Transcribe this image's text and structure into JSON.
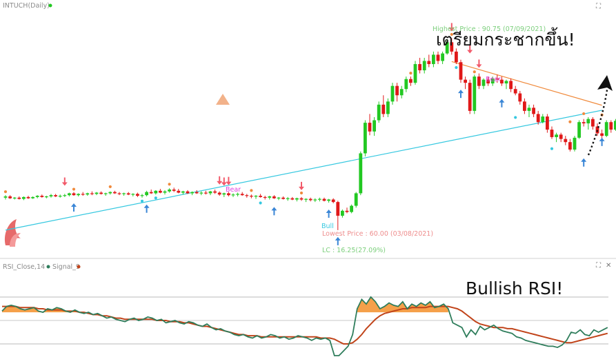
{
  "chart_data": [
    {
      "type": "candlestick",
      "title": "INTUCH(Daily)",
      "price_range": [
        58,
        93
      ],
      "annotations": {
        "highest": "Highest Price : 90.75 (07/09/2021)",
        "lowest": "Lowest Price : 60.00 (03/08/2021)",
        "lc": "LC : 16.25(27.09%)",
        "bear_1": "Bear",
        "bear_2": "Bear",
        "bull": "Bull",
        "headline": "เตรียมกระชากขึ้น!"
      },
      "colors": {
        "up": "#22c822",
        "down": "#e01818",
        "support": "#35c8e0",
        "resistance": "#f08a3c"
      },
      "trendlines": [
        {
          "name": "support",
          "from": [
            0,
            60.0
          ],
          "to": [
            131,
            79.2
          ]
        },
        {
          "name": "resistance",
          "from": [
            98,
            87.0
          ],
          "to": [
            131,
            80.0
          ]
        }
      ],
      "candles": [
        [
          65.2,
          65.6,
          64.9,
          65.4
        ],
        [
          65.4,
          65.6,
          65.0,
          65.1
        ],
        [
          65.1,
          65.3,
          64.9,
          65.2
        ],
        [
          65.2,
          65.4,
          64.9,
          65.0
        ],
        [
          65.0,
          65.4,
          64.8,
          65.3
        ],
        [
          65.3,
          65.5,
          65.0,
          65.1
        ],
        [
          65.1,
          65.4,
          65.0,
          65.3
        ],
        [
          65.3,
          65.6,
          65.1,
          65.5
        ],
        [
          65.5,
          65.7,
          65.2,
          65.3
        ],
        [
          65.3,
          65.5,
          65.1,
          65.4
        ],
        [
          65.4,
          65.8,
          65.2,
          65.6
        ],
        [
          65.6,
          65.8,
          65.3,
          65.4
        ],
        [
          65.4,
          65.7,
          65.2,
          65.5
        ],
        [
          65.5,
          65.8,
          65.3,
          65.6
        ],
        [
          65.6,
          66.0,
          65.4,
          65.9
        ],
        [
          65.9,
          66.1,
          65.5,
          65.6
        ],
        [
          65.6,
          65.9,
          65.4,
          65.8
        ],
        [
          65.8,
          66.1,
          65.5,
          65.7
        ],
        [
          65.7,
          66.0,
          65.5,
          65.9
        ],
        [
          65.9,
          66.2,
          65.6,
          65.8
        ],
        [
          65.8,
          66.1,
          65.6,
          66.0
        ],
        [
          66.0,
          66.2,
          65.7,
          65.8
        ],
        [
          65.8,
          66.0,
          65.5,
          65.9
        ],
        [
          65.9,
          66.2,
          65.7,
          66.1
        ],
        [
          66.1,
          66.3,
          65.8,
          65.9
        ],
        [
          65.9,
          66.1,
          65.6,
          65.8
        ],
        [
          65.8,
          66.0,
          65.5,
          65.9
        ],
        [
          65.9,
          66.1,
          65.6,
          65.7
        ],
        [
          65.7,
          65.9,
          65.4,
          65.8
        ],
        [
          65.8,
          66.0,
          65.3,
          65.5
        ],
        [
          65.5,
          65.8,
          65.2,
          65.6
        ],
        [
          65.6,
          66.3,
          65.4,
          66.1
        ],
        [
          66.1,
          66.5,
          65.8,
          65.9
        ],
        [
          65.9,
          66.4,
          65.7,
          66.3
        ],
        [
          66.3,
          66.6,
          65.9,
          66.0
        ],
        [
          66.0,
          66.4,
          65.7,
          66.2
        ],
        [
          66.2,
          66.7,
          66.0,
          66.5
        ],
        [
          66.5,
          66.8,
          66.1,
          66.3
        ],
        [
          66.3,
          66.6,
          65.9,
          66.0
        ],
        [
          66.0,
          66.3,
          65.7,
          66.2
        ],
        [
          66.2,
          66.4,
          65.8,
          65.9
        ],
        [
          65.9,
          66.2,
          65.6,
          66.1
        ],
        [
          66.1,
          66.4,
          65.8,
          65.9
        ],
        [
          65.9,
          66.2,
          65.6,
          66.0
        ],
        [
          66.0,
          66.3,
          65.7,
          65.9
        ],
        [
          65.9,
          66.3,
          65.6,
          66.2
        ],
        [
          66.2,
          66.5,
          65.8,
          66.0
        ],
        [
          66.0,
          66.2,
          65.5,
          65.7
        ],
        [
          65.7,
          66.0,
          65.3,
          65.9
        ],
        [
          65.9,
          66.1,
          65.4,
          65.6
        ],
        [
          65.6,
          65.9,
          65.3,
          65.7
        ],
        [
          65.7,
          66.0,
          65.4,
          65.8
        ],
        [
          65.8,
          66.1,
          65.5,
          65.6
        ],
        [
          65.6,
          65.8,
          65.2,
          65.5
        ],
        [
          65.5,
          65.7,
          65.1,
          65.4
        ],
        [
          65.4,
          65.6,
          65.0,
          65.5
        ],
        [
          65.5,
          65.8,
          65.2,
          65.3
        ],
        [
          65.3,
          65.5,
          64.9,
          65.2
        ],
        [
          65.2,
          65.5,
          64.9,
          65.4
        ],
        [
          65.4,
          65.6,
          65.0,
          65.1
        ],
        [
          65.1,
          65.3,
          64.8,
          65.2
        ],
        [
          65.2,
          65.4,
          64.9,
          65.0
        ],
        [
          65.0,
          65.3,
          64.7,
          65.1
        ],
        [
          65.1,
          65.3,
          64.8,
          64.9
        ],
        [
          64.9,
          65.2,
          64.6,
          65.1
        ],
        [
          65.1,
          65.3,
          64.7,
          64.9
        ],
        [
          64.9,
          65.1,
          64.5,
          65.0
        ],
        [
          65.0,
          65.2,
          64.6,
          64.8
        ],
        [
          64.8,
          65.1,
          64.5,
          64.9
        ],
        [
          64.9,
          65.2,
          64.6,
          65.0
        ],
        [
          65.0,
          65.2,
          64.6,
          64.7
        ],
        [
          64.7,
          65.0,
          64.4,
          64.9
        ],
        [
          64.9,
          65.1,
          64.3,
          64.5
        ],
        [
          64.5,
          64.7,
          60.0,
          62.3
        ],
        [
          62.3,
          63.3,
          62.0,
          63.1
        ],
        [
          63.1,
          63.6,
          62.7,
          62.9
        ],
        [
          62.9,
          64.1,
          62.7,
          63.9
        ],
        [
          63.9,
          66.1,
          63.6,
          65.9
        ],
        [
          65.9,
          72.6,
          65.6,
          72.3
        ],
        [
          72.3,
          77.6,
          71.8,
          77.2
        ],
        [
          77.2,
          78.6,
          75.2,
          75.8
        ],
        [
          75.8,
          78.1,
          75.1,
          77.6
        ],
        [
          77.6,
          80.6,
          77.2,
          80.1
        ],
        [
          80.1,
          81.6,
          78.1,
          78.6
        ],
        [
          78.6,
          81.1,
          78.1,
          80.6
        ],
        [
          80.6,
          83.6,
          80.1,
          83.1
        ],
        [
          83.1,
          83.6,
          80.6,
          81.6
        ],
        [
          81.6,
          83.1,
          81.1,
          82.6
        ],
        [
          82.6,
          84.6,
          82.1,
          84.2
        ],
        [
          84.2,
          84.6,
          83.1,
          83.6
        ],
        [
          83.6,
          87.1,
          83.3,
          86.6
        ],
        [
          86.6,
          87.6,
          85.1,
          85.6
        ],
        [
          85.6,
          87.6,
          85.1,
          87.1
        ],
        [
          87.1,
          88.1,
          86.1,
          86.6
        ],
        [
          86.6,
          88.6,
          86.1,
          88.1
        ],
        [
          88.1,
          88.6,
          86.6,
          87.1
        ],
        [
          87.1,
          88.6,
          86.6,
          88.3
        ],
        [
          88.3,
          90.6,
          88.1,
          90.1
        ],
        [
          90.1,
          90.75,
          88.1,
          88.6
        ],
        [
          88.6,
          89.1,
          86.6,
          86.9
        ],
        [
          86.9,
          87.3,
          83.6,
          84.1
        ],
        [
          84.1,
          84.6,
          82.6,
          83.6
        ],
        [
          83.6,
          84.1,
          78.6,
          79.1
        ],
        [
          79.1,
          84.9,
          78.6,
          84.6
        ],
        [
          84.6,
          85.1,
          82.6,
          83.1
        ],
        [
          83.1,
          84.3,
          82.6,
          84.1
        ],
        [
          84.1,
          84.6,
          83.1,
          83.5
        ],
        [
          83.5,
          84.6,
          83.1,
          84.3
        ],
        [
          84.3,
          84.9,
          83.6,
          84.1
        ],
        [
          84.1,
          84.6,
          83.1,
          83.5
        ],
        [
          83.5,
          84.1,
          82.6,
          83.9
        ],
        [
          83.9,
          84.3,
          82.1,
          82.6
        ],
        [
          82.6,
          83.1,
          81.6,
          81.9
        ],
        [
          81.9,
          82.3,
          80.1,
          80.6
        ],
        [
          80.6,
          81.1,
          78.6,
          79.1
        ],
        [
          79.1,
          80.1,
          78.1,
          79.6
        ],
        [
          79.6,
          80.1,
          78.1,
          78.6
        ],
        [
          78.6,
          79.1,
          76.9,
          77.3
        ],
        [
          77.3,
          78.6,
          77.1,
          78.2
        ],
        [
          78.2,
          78.6,
          75.6,
          76.1
        ],
        [
          76.1,
          76.6,
          74.6,
          74.9
        ],
        [
          74.9,
          75.6,
          74.1,
          75.3
        ],
        [
          75.3,
          75.6,
          74.1,
          74.6
        ],
        [
          74.6,
          75.1,
          73.6,
          74.1
        ],
        [
          74.1,
          74.6,
          72.6,
          72.9
        ],
        [
          72.9,
          75.1,
          72.6,
          74.8
        ],
        [
          74.8,
          77.6,
          74.6,
          77.3
        ],
        [
          77.3,
          77.8,
          76.6,
          77.1
        ],
        [
          77.1,
          78.1,
          76.1,
          77.8
        ],
        [
          77.8,
          78.1,
          76.1,
          76.6
        ],
        [
          76.6,
          77.1,
          75.1,
          75.5
        ],
        [
          75.5,
          76.1,
          74.6,
          75.1
        ],
        [
          75.1,
          77.6,
          74.9,
          77.3
        ],
        [
          77.3,
          77.6,
          75.6,
          76.1
        ],
        [
          76.1,
          77.8,
          75.9,
          77.5
        ]
      ]
    },
    {
      "type": "line",
      "title": "RSI_Close,14",
      "signal_label": "Signal_9",
      "headline": "Bullish RSI!",
      "series": [
        {
          "name": "RSI_Close,14",
          "color": "#2e7d5b",
          "values": [
            58,
            62,
            63,
            62,
            60,
            59,
            60,
            61,
            58,
            57,
            60,
            59,
            61,
            60,
            58,
            57,
            59,
            57,
            56,
            57,
            55,
            56,
            54,
            52,
            53,
            51,
            50,
            49,
            51,
            52,
            50,
            51,
            53,
            52,
            50,
            51,
            48,
            49,
            50,
            48,
            47,
            49,
            48,
            46,
            45,
            47,
            44,
            42,
            43,
            41,
            40,
            38,
            37,
            38,
            36,
            35,
            37,
            35,
            36,
            38,
            37,
            35,
            36,
            34,
            35,
            37,
            36,
            35,
            33,
            35,
            34,
            35,
            33,
            20,
            12,
            24,
            28,
            38,
            60,
            68,
            64,
            70,
            66,
            60,
            62,
            65,
            63,
            62,
            66,
            60,
            64,
            62,
            65,
            63,
            66,
            61,
            62,
            64,
            60,
            48,
            46,
            44,
            36,
            42,
            38,
            45,
            42,
            44,
            46,
            43,
            41,
            40,
            39,
            36,
            35,
            33,
            32,
            31,
            30,
            29,
            28,
            28,
            27,
            29,
            33,
            40,
            39,
            42,
            38,
            37,
            42,
            40,
            42,
            44
          ]
        },
        {
          "name": "Signal_9",
          "color": "#c1441a",
          "values": [
            62,
            62,
            62,
            62,
            61,
            61,
            61,
            61,
            60,
            60,
            59,
            59,
            59,
            59,
            58,
            58,
            58,
            57,
            57,
            56,
            55,
            55,
            54,
            54,
            53,
            52,
            52,
            51,
            51,
            51,
            51,
            51,
            51,
            51,
            50,
            50,
            50,
            49,
            49,
            49,
            48,
            48,
            47,
            46,
            45,
            45,
            44,
            43,
            42,
            41,
            40,
            39,
            38,
            38,
            37,
            37,
            37,
            36,
            36,
            36,
            36,
            36,
            36,
            36,
            36,
            36,
            36,
            36,
            36,
            36,
            35,
            35,
            35,
            34,
            32,
            30,
            30,
            31,
            34,
            38,
            43,
            47,
            51,
            54,
            56,
            57,
            58,
            59,
            60,
            60,
            61,
            61,
            61,
            61,
            62,
            62,
            62,
            62,
            62,
            61,
            60,
            58,
            55,
            52,
            49,
            47,
            46,
            45,
            44,
            44,
            44,
            43,
            43,
            42,
            41,
            40,
            39,
            38,
            37,
            36,
            35,
            34,
            33,
            32,
            31,
            31,
            32,
            33,
            34,
            35,
            36,
            37,
            38,
            39
          ]
        }
      ],
      "ylim": [
        20,
        70
      ]
    }
  ]
}
